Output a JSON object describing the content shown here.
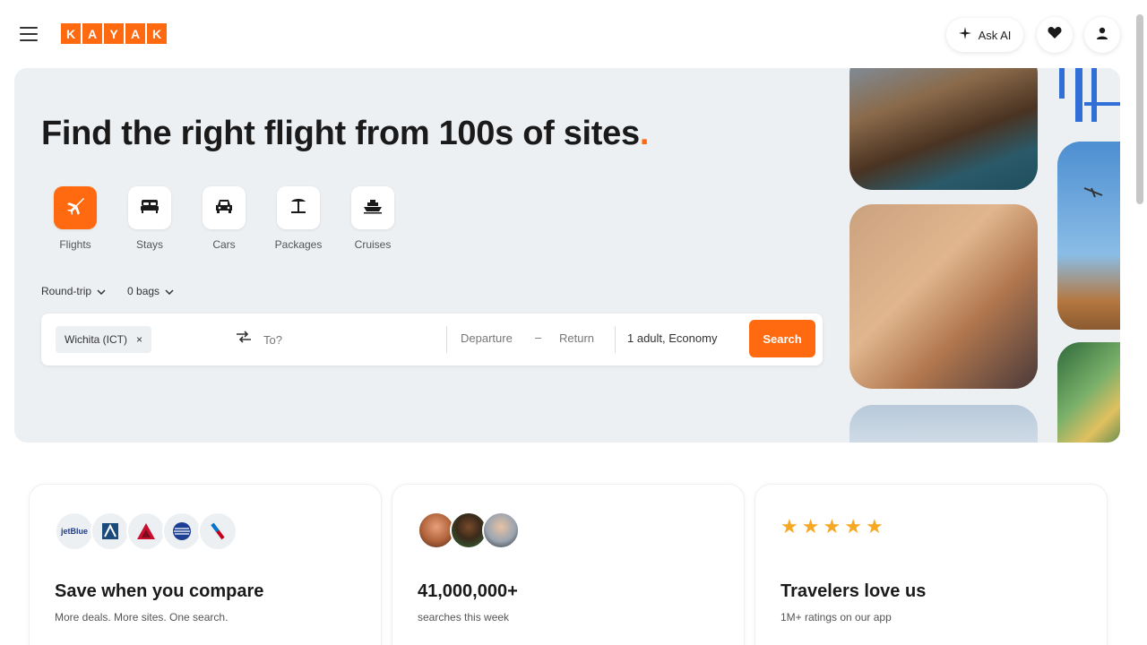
{
  "header": {
    "logo_letters": [
      "K",
      "A",
      "Y",
      "A",
      "K"
    ],
    "ask_ai_label": "Ask AI"
  },
  "hero": {
    "title": "Find the right flight from 100s of sites",
    "title_dot": ".",
    "verticals": [
      {
        "label": "Flights",
        "icon": "plane-icon",
        "active": true
      },
      {
        "label": "Stays",
        "icon": "bed-icon",
        "active": false
      },
      {
        "label": "Cars",
        "icon": "car-icon",
        "active": false
      },
      {
        "label": "Packages",
        "icon": "beach-umbrella-icon",
        "active": false
      },
      {
        "label": "Cruises",
        "icon": "ship-icon",
        "active": false
      }
    ],
    "options": {
      "trip_type": "Round-trip",
      "bags": "0 bags"
    },
    "search": {
      "origin": "Wichita (ICT)",
      "origin_remove": "×",
      "destination_placeholder": "To?",
      "departure": "Departure",
      "date_separator": "–",
      "return": "Return",
      "travelers": "1 adult, Economy",
      "button": "Search"
    }
  },
  "cards": [
    {
      "title": "Save when you compare",
      "subtitle": "More deals. More sites. One search.",
      "logos": [
        "jetBlue",
        "alaska",
        "delta",
        "united",
        "american"
      ]
    },
    {
      "title": "41,000,000+",
      "subtitle": "searches this week"
    },
    {
      "title": "Travelers love us",
      "subtitle": "1M+ ratings on our app",
      "stars": 5
    }
  ],
  "colors": {
    "brand": "#ff690f",
    "hero_bg": "#edf0f3",
    "star": "#f7a823"
  },
  "airline_labels": {
    "jetblue": "jetBlue"
  }
}
